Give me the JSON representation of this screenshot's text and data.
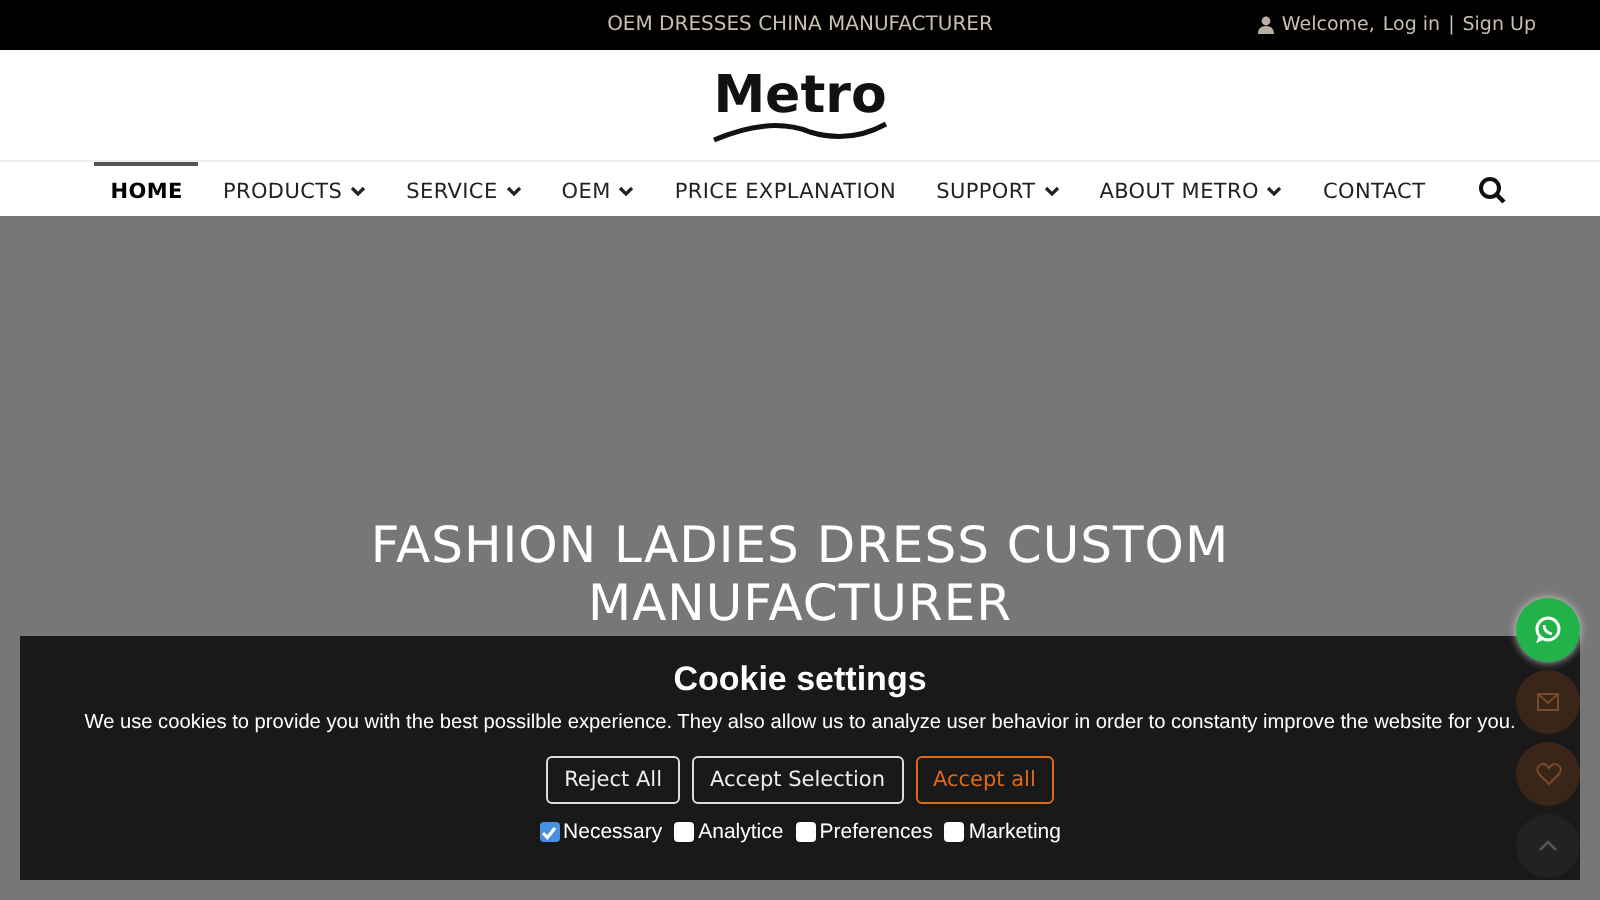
{
  "top_bar": {
    "tagline": "OEM DRESSES CHINA MANUFACTURER",
    "welcome": "Welcome,",
    "login": "Log in",
    "separator": "|",
    "signup": "Sign Up"
  },
  "logo": {
    "text": "Metro"
  },
  "nav": [
    {
      "label": "HOME",
      "selected": true,
      "dropdown": false
    },
    {
      "label": "PRODUCTS",
      "selected": false,
      "dropdown": true
    },
    {
      "label": "SERVICE",
      "selected": false,
      "dropdown": true
    },
    {
      "label": "OEM",
      "selected": false,
      "dropdown": true
    },
    {
      "label": "PRICE EXPLANATION",
      "selected": false,
      "dropdown": false
    },
    {
      "label": "SUPPORT",
      "selected": false,
      "dropdown": true
    },
    {
      "label": "ABOUT METRO",
      "selected": false,
      "dropdown": true
    },
    {
      "label": "CONTACT",
      "selected": false,
      "dropdown": false
    }
  ],
  "hero": {
    "title": "FASHION LADIES DRESS CUSTOM MANUFACTURER"
  },
  "cookie_banner": {
    "title": "Cookie settings",
    "text": "We use cookies to provide you with the best possilble experience. They also allow us to analyze user behavior in order to constanty improve the website for you.",
    "buttons": [
      {
        "label": "Reject All",
        "kind": "plain"
      },
      {
        "label": "Accept Selection",
        "kind": "plain"
      },
      {
        "label": "Accept all",
        "kind": "accent"
      }
    ],
    "options": [
      {
        "label": "Necessary",
        "checked": true
      },
      {
        "label": "Analytice",
        "checked": false
      },
      {
        "label": "Preferences",
        "checked": false
      },
      {
        "label": "Marketing",
        "checked": false
      }
    ]
  },
  "float_buttons": [
    {
      "kind": "whatsapp"
    },
    {
      "kind": "mail"
    },
    {
      "kind": "heart"
    },
    {
      "kind": "top"
    }
  ]
}
